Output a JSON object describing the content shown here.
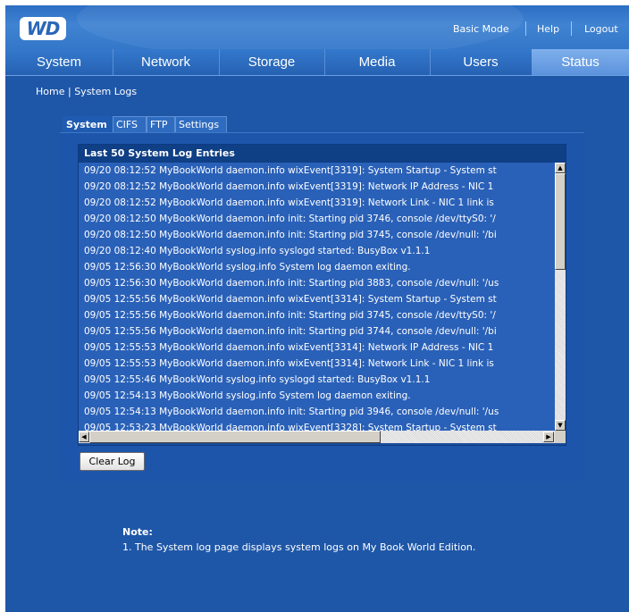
{
  "header": {
    "logo_text": "WD",
    "links": [
      "Basic Mode",
      "Help",
      "Logout"
    ]
  },
  "nav": {
    "tabs": [
      "System",
      "Network",
      "Storage",
      "Media",
      "Users",
      "Status"
    ],
    "active": "Status"
  },
  "breadcrumb": {
    "home": "Home",
    "separator": "|",
    "current": "System Logs"
  },
  "subtabs": {
    "items": [
      "System",
      "CIFS",
      "FTP",
      "Settings"
    ],
    "active": "System"
  },
  "log": {
    "title": "Last 50 System Log Entries",
    "entries": [
      "09/20 08:12:52  MyBookWorld daemon.info wixEvent[3319]: System Startup - System st",
      "09/20 08:12:52  MyBookWorld daemon.info wixEvent[3319]: Network IP Address - NIC 1",
      "09/20 08:12:52  MyBookWorld daemon.info wixEvent[3319]: Network Link - NIC 1 link is",
      "09/20 08:12:50  MyBookWorld daemon.info init: Starting pid 3746, console /dev/ttyS0: '/",
      "09/20 08:12:50  MyBookWorld daemon.info init: Starting pid 3745, console /dev/null: '/bi",
      "09/20 08:12:40  MyBookWorld syslog.info syslogd started: BusyBox v1.1.1",
      "09/05 12:56:30  MyBookWorld syslog.info System log daemon exiting.",
      "09/05 12:56:30  MyBookWorld daemon.info init: Starting pid 3883, console /dev/null: '/us",
      "09/05 12:55:56  MyBookWorld daemon.info wixEvent[3314]: System Startup - System st",
      "09/05 12:55:56  MyBookWorld daemon.info init: Starting pid 3745, console /dev/ttyS0: '/",
      "09/05 12:55:56  MyBookWorld daemon.info init: Starting pid 3744, console /dev/null: '/bi",
      "09/05 12:55:53  MyBookWorld daemon.info wixEvent[3314]: Network IP Address - NIC 1",
      "09/05 12:55:53  MyBookWorld daemon.info wixEvent[3314]: Network Link - NIC 1 link is",
      "09/05 12:55:46  MyBookWorld syslog.info syslogd started: BusyBox v1.1.1",
      "09/05 12:54:13  MyBookWorld syslog.info System log daemon exiting.",
      "09/05 12:54:13  MyBookWorld daemon.info init: Starting pid 3946, console /dev/null: '/us",
      "09/05 12:53:23  MyBookWorld daemon.info wixEvent[3328]: System Startup - System st"
    ],
    "clear_button": "Clear Log"
  },
  "note": {
    "title": "Note:",
    "item": "1.  The System log page displays system logs on My Book World Edition."
  },
  "colors": {
    "background": "#1f57a8",
    "panel": "#1d55aa",
    "active_tab": "#6aa2e6"
  }
}
